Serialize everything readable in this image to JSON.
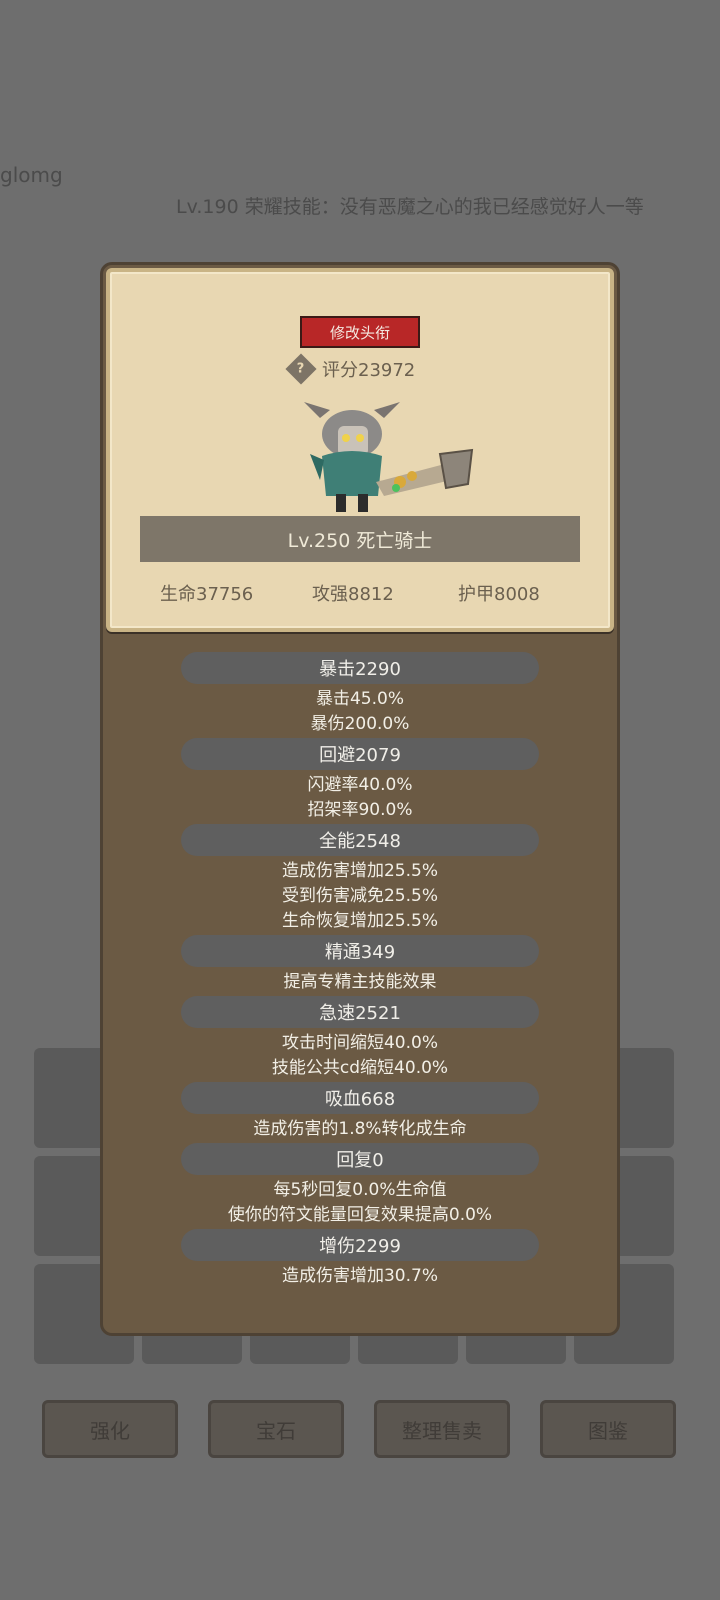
{
  "background": {
    "player_name": "glomg",
    "title_line": "Lv.190 荣耀技能：没有恶魔之心的我已经感觉好人一等",
    "buttons": [
      "强化",
      "宝石",
      "整理售卖",
      "图鉴"
    ]
  },
  "card": {
    "edit_title_label": "修改头衔",
    "score": "评分23972",
    "name_level": "Lv.250 死亡骑士",
    "life": "生命37756",
    "attack": "攻强8812",
    "armor": "护甲8008"
  },
  "attributes": [
    {
      "head": "暴击2290",
      "lines": [
        "暴击45.0%",
        "暴伤200.0%"
      ]
    },
    {
      "head": "回避2079",
      "lines": [
        "闪避率40.0%",
        "招架率90.0%"
      ]
    },
    {
      "head": "全能2548",
      "lines": [
        "造成伤害增加25.5%",
        "受到伤害减免25.5%",
        "生命恢复增加25.5%"
      ]
    },
    {
      "head": "精通349",
      "lines": [
        "提高专精主技能效果"
      ]
    },
    {
      "head": "急速2521",
      "lines": [
        "攻击时间缩短40.0%",
        "技能公共cd缩短40.0%"
      ]
    },
    {
      "head": "吸血668",
      "lines": [
        "造成伤害的1.8%转化成生命"
      ]
    },
    {
      "head": "回复0",
      "lines": [
        "每5秒回复0.0%生命值",
        "使你的符文能量回复效果提高0.0%"
      ]
    },
    {
      "head": "增伤2299",
      "lines": [
        "造成伤害增加30.7%"
      ]
    }
  ],
  "colors": {
    "accent_red": "#b82727",
    "parchment": "#e8d7b2",
    "panel": "#6b5a44"
  }
}
